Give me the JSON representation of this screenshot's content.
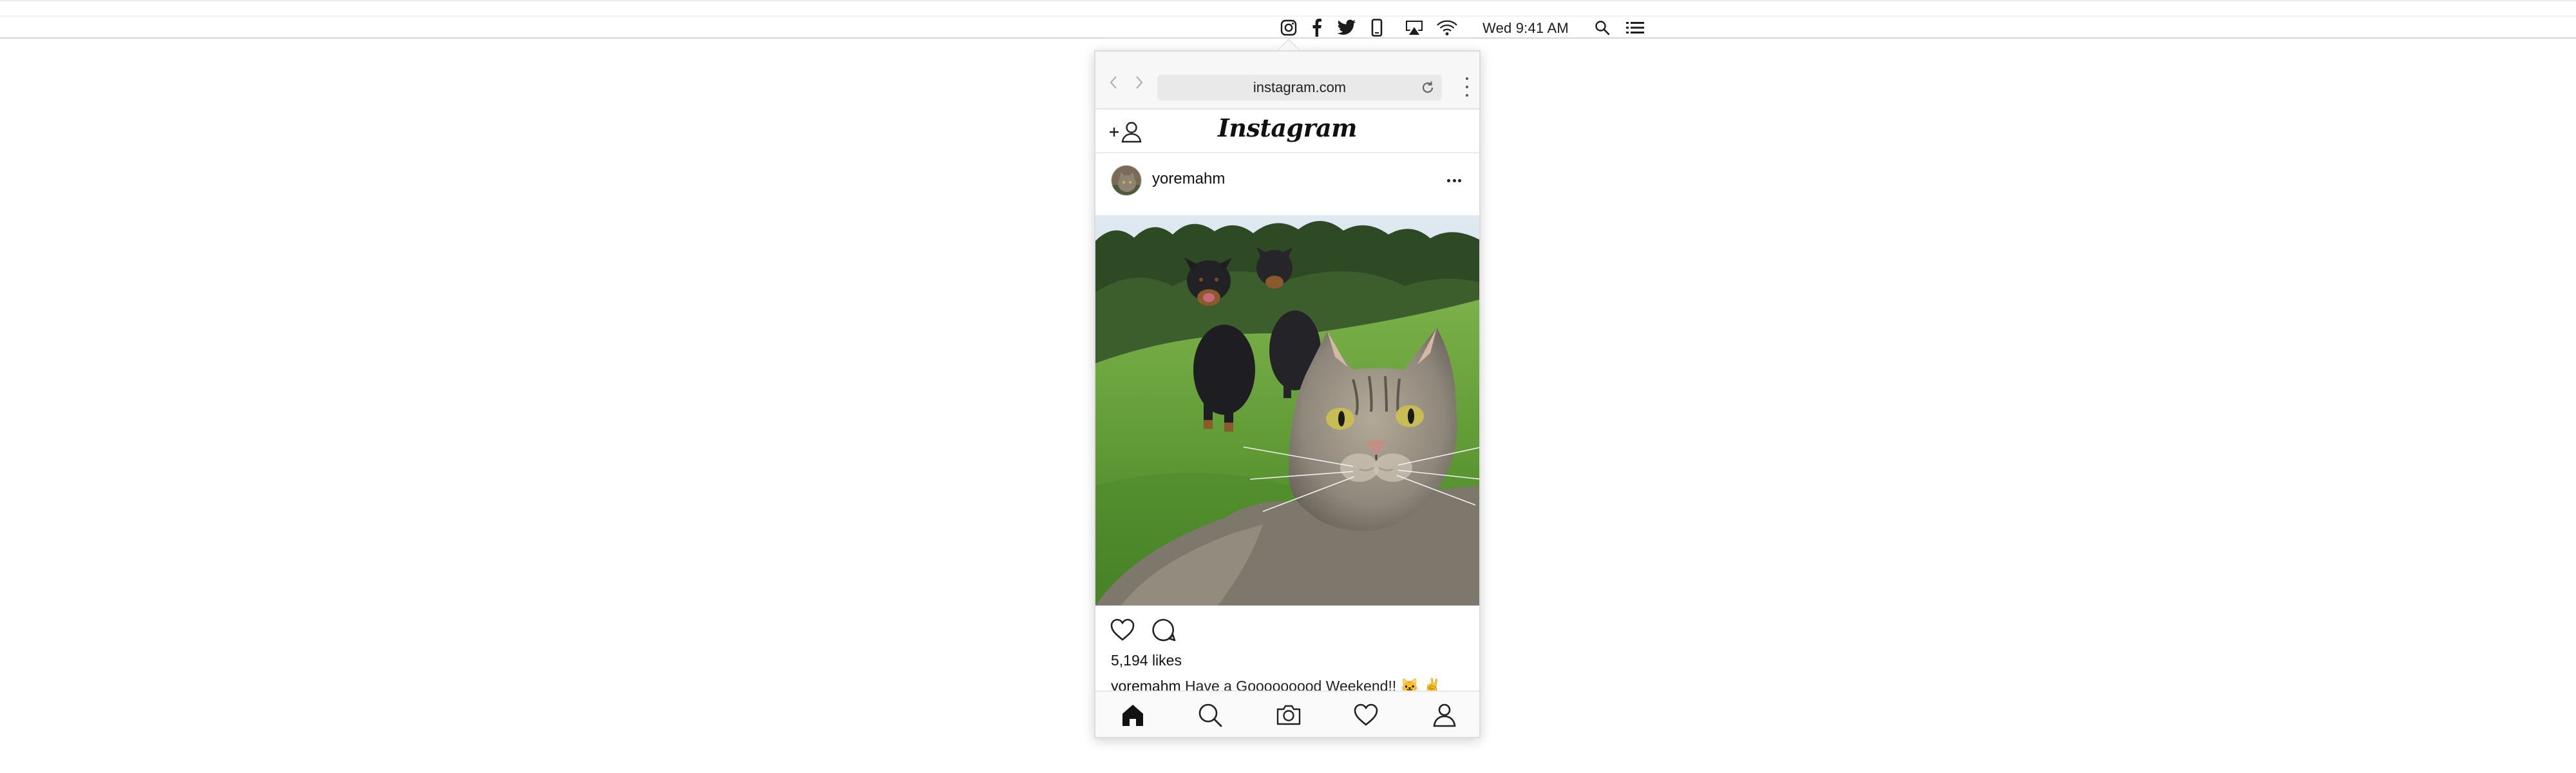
{
  "menubar": {
    "clock": "Wed 9:41 AM",
    "status_icons": [
      "instagram-icon",
      "facebook-icon",
      "twitter-icon",
      "phone-icon",
      "airplay-icon",
      "wifi-icon",
      "search-icon",
      "list-icon"
    ]
  },
  "browser": {
    "url": "instagram.com"
  },
  "instagram": {
    "logo": "Instagram",
    "post": {
      "username": "yoremahm",
      "likes": "5,194 likes",
      "caption_user": "yoremahm",
      "caption_text": "Have a Gooooooood Weekend!! 🐱 ✌"
    }
  },
  "colors": {
    "accent": "#111111",
    "grass": "#5f9a35",
    "sky": "#dbe6ef"
  }
}
